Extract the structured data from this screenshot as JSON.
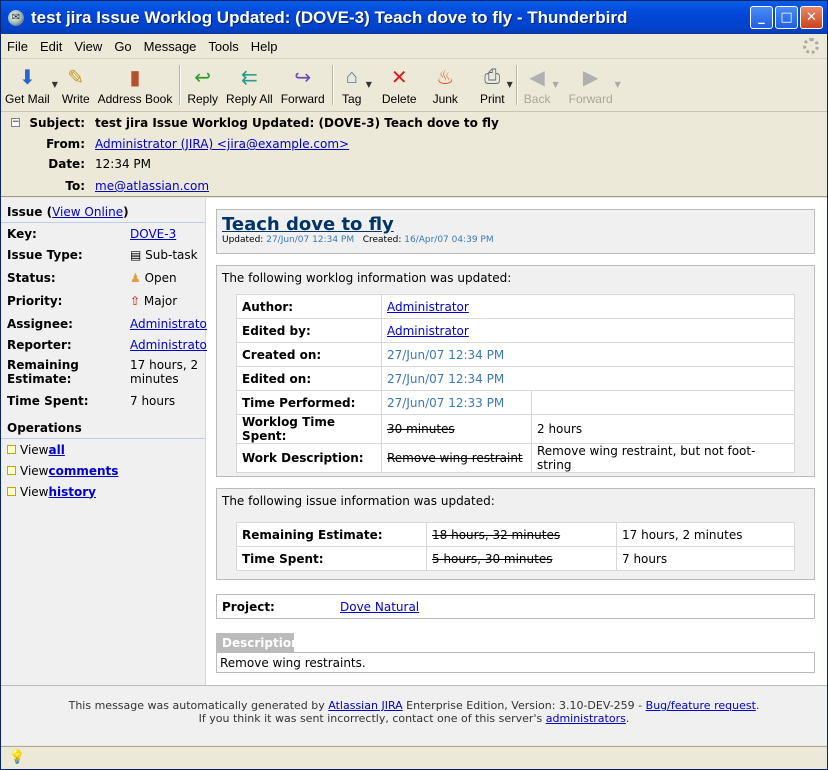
{
  "window": {
    "title": "test jira Issue Worklog Updated: (DOVE-3) Teach dove to fly - Thunderbird",
    "minimize": "_",
    "maximize": "□",
    "close": "✕"
  },
  "menu": [
    "File",
    "Edit",
    "View",
    "Go",
    "Message",
    "Tools",
    "Help"
  ],
  "toolbar": {
    "get_mail": "Get Mail",
    "write": "Write",
    "address_book": "Address Book",
    "reply": "Reply",
    "reply_all": "Reply All",
    "forward": "Forward",
    "tag": "Tag",
    "delete": "Delete",
    "junk": "Junk",
    "print": "Print",
    "back": "Back",
    "forward_nav": "Forward"
  },
  "header": {
    "subject_label": "Subject:",
    "subject": "test jira Issue Worklog Updated: (DOVE-3) Teach dove to fly",
    "from_label": "From:",
    "from": "Administrator (JIRA) <jira@example.com>",
    "date_label": "Date:",
    "date": "12:34 PM",
    "to_label": "To:",
    "to": "me@atlassian.com"
  },
  "sidebar": {
    "issue_head": "Issue",
    "view_online": "View Online",
    "key_label": "Key:",
    "key": "DOVE-3",
    "type_label": "Issue Type:",
    "type": "Sub-task",
    "status_label": "Status:",
    "status": "Open",
    "priority_label": "Priority:",
    "priority": "Major",
    "assignee_label": "Assignee:",
    "assignee": "Administrator",
    "reporter_label": "Reporter:",
    "reporter": "Administrator",
    "remaining_label": "Remaining Estimate:",
    "remaining": "17 hours, 2 minutes",
    "spent_label": "Time Spent:",
    "spent": "7 hours",
    "operations_head": "Operations",
    "ops": [
      {
        "prefix": "View ",
        "link": "all"
      },
      {
        "prefix": "View ",
        "link": "comments"
      },
      {
        "prefix": "View ",
        "link": "history"
      }
    ]
  },
  "issue": {
    "title": "Teach dove to fly",
    "updated_label": "Updated:",
    "updated": "27/Jun/07 12:34 PM",
    "created_label": "Created:",
    "created": "16/Apr/07 04:39 PM"
  },
  "worklog": {
    "heading": "The following worklog information was updated:",
    "author_label": "Author:",
    "author": "Administrator",
    "edited_by_label": "Edited by:",
    "edited_by": "Administrator",
    "created_on_label": "Created on:",
    "created_on": "27/Jun/07 12:34 PM",
    "edited_on_label": "Edited on:",
    "edited_on": "27/Jun/07 12:34 PM",
    "performed_label": "Time Performed:",
    "performed": "27/Jun/07 12:33 PM",
    "time_spent_label": "Worklog Time Spent:",
    "time_spent_old": "30 minutes",
    "time_spent_new": "2 hours",
    "desc_label": "Work Description:",
    "desc_old": "Remove wing restraint",
    "desc_new": "Remove wing restraint, but not foot-string"
  },
  "issueinfo": {
    "heading": "The following issue information was updated:",
    "remaining_label": "Remaining Estimate:",
    "remaining_old": "18 hours, 32 minutes",
    "remaining_new": "17 hours, 2 minutes",
    "spent_label": "Time Spent:",
    "spent_old": "5 hours, 30 minutes",
    "spent_new": "7 hours"
  },
  "project": {
    "label": "Project:",
    "value": "Dove Natural"
  },
  "description": {
    "tab": "Description",
    "text": "Remove wing restraints."
  },
  "footer": {
    "l1_a": "This message was automatically generated by ",
    "l1_link1": "Atlassian JIRA",
    "l1_b": " Enterprise Edition, Version: 3.10-DEV-259 - ",
    "l1_link2": "Bug/feature request",
    "l1_c": ".",
    "l2_a": "If you think it was sent incorrectly, contact one of this server's ",
    "l2_link": "administrators",
    "l2_b": "."
  }
}
